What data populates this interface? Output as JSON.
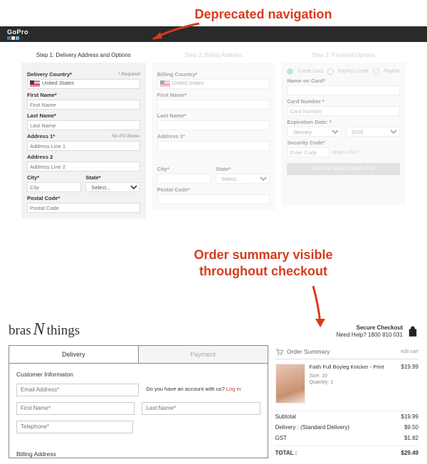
{
  "annotations": {
    "top": "Deprecated navigation",
    "mid_line1": "Order summary visible",
    "mid_line2": "throughout checkout"
  },
  "gopro": {
    "logo_text": "GoPro",
    "step1": {
      "title": "Step 1: Delivery Address and Options",
      "delivery_country_label": "Delivery Country*",
      "required_hint": "* Required",
      "country_value": "United States",
      "first_name_label": "First Name*",
      "first_name_ph": "First Name",
      "last_name_label": "Last Name*",
      "last_name_ph": "Last Name",
      "address1_label": "Address 1*",
      "address1_hint": "No PO Boxes",
      "address1_ph": "Address Line 1",
      "address2_label": "Address 2",
      "address2_ph": "Address Line 2",
      "city_label": "City*",
      "city_ph": "City",
      "state_label": "State*",
      "state_value": "Select...",
      "postal_label": "Postal Code*",
      "postal_ph": "Postal Code"
    },
    "step2": {
      "title": "Step 2: Billing Address",
      "billing_country_label": "Billing Country*",
      "country_value": "United States",
      "first_name_label": "First Name*",
      "last_name_label": "Last Name*",
      "address1_label": "Address 1*",
      "city_label": "City*",
      "state_label": "State*",
      "state_value": "Select...",
      "postal_label": "Postal Code*"
    },
    "step3": {
      "title": "Step 3: Payment Options",
      "opt_credit": "Credit Card",
      "opt_ppcredit": "PayPal Credit",
      "opt_pp": "PayPal",
      "name_label": "Name on Card*",
      "card_label": "Card Number *",
      "card_ph": "Card Number",
      "exp_label": "Expiration Date: *",
      "exp_month": "January",
      "exp_year": "2016",
      "sec_label": "Security Code*",
      "sec_ph": "Enter Code",
      "whatsthis": "What is this?",
      "review_btn": "REVIEW AND COMPLETE"
    }
  },
  "bnt": {
    "logo_a": "bras",
    "logo_n": "N",
    "logo_b": "things",
    "secure_title": "Secure Checkout",
    "secure_help": "Need Help?  1800 810 031",
    "tab_delivery": "Delivery",
    "tab_payment": "Payment",
    "section_customer": "Customer Informaton",
    "email_ph": "Email Address*",
    "login_q": "Do you have an account with us? ",
    "login_link": "Log in",
    "firstname_ph": "First Name*",
    "lastname_ph": "Last Name*",
    "telephone_ph": "Telephone*",
    "billing_label": "Billing Address",
    "summary": {
      "title": "Order Summary",
      "edit": "edit cart",
      "item_name": "Faith Full Boyleg Knicker - Print",
      "item_size": "Size: 10",
      "item_qty": "Quantity: 1",
      "item_price": "$19.99",
      "subtotal_label": "Subtotal",
      "subtotal_val": "$19.99",
      "delivery_label": "Delivery : (Standard Delivery)",
      "delivery_val": "$9.50",
      "gst_label": "GST",
      "gst_val": "$1.82",
      "total_label": "TOTAL :",
      "total_val": "$29.49"
    }
  }
}
